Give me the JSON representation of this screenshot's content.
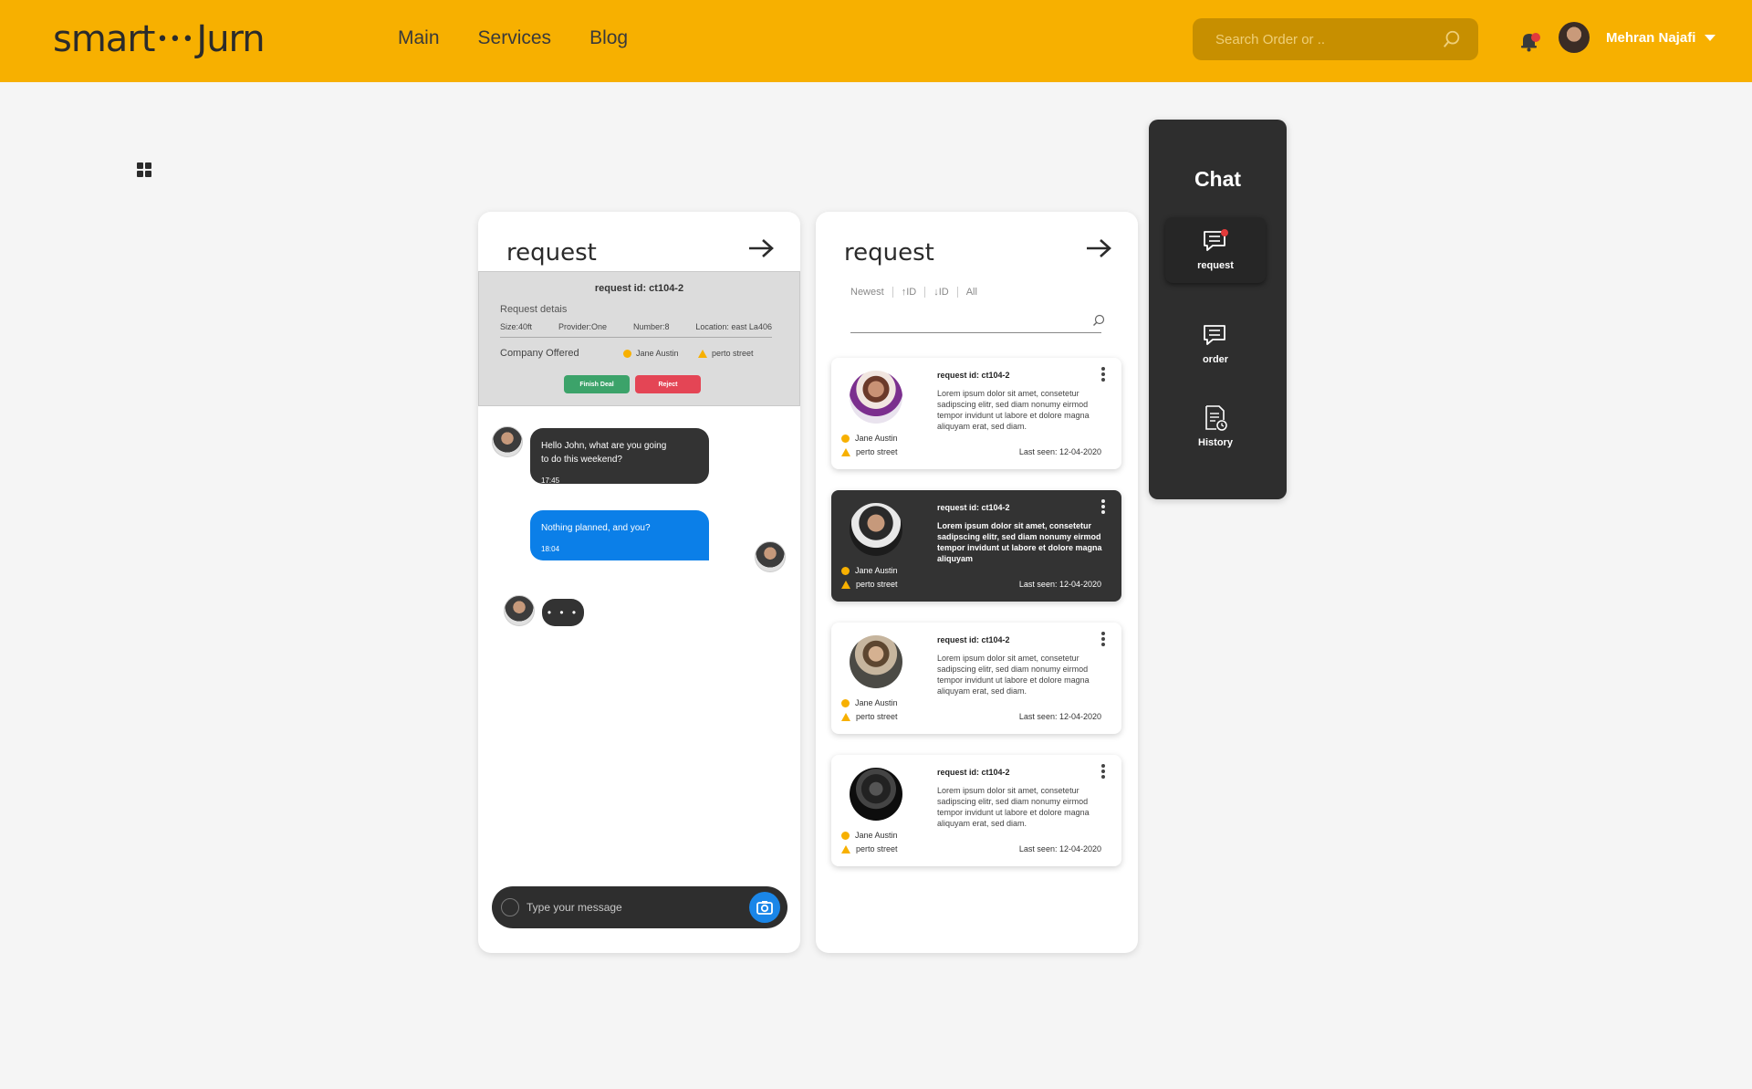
{
  "header": {
    "logo_left": "smart",
    "logo_dots": "•••",
    "logo_right": "Jurn",
    "nav": [
      "Main",
      "Services",
      "Blog"
    ],
    "search_placeholder": "Search Order or ..",
    "user_name": "Mehran Najafi",
    "brand_color": "#f7b000"
  },
  "request_panel": {
    "title": "request",
    "request_id": "request id: ct104-2",
    "details_label": "Request detais",
    "specs": [
      "Size:40ft",
      "Provider:One",
      "Number:8",
      "Location: east La406"
    ],
    "company_label": "Company Offered",
    "person": "Jane Austin",
    "street": "perto street",
    "finish_label": "Finish Deal",
    "reject_label": "Reject",
    "messages": [
      {
        "text_line1": "Hello John, what are you going",
        "text_line2": "to do this weekend?",
        "time": "17:45"
      },
      {
        "text": "Nothing planned, and you?",
        "time": "18:04"
      }
    ],
    "typing": "• • •",
    "compose_placeholder": "Type your message"
  },
  "list_panel": {
    "title": "request",
    "filters": [
      "Newest",
      "↑ID",
      "↓ID",
      "All"
    ],
    "cards": [
      {
        "id": "request id: ct104-2",
        "text": "Lorem ipsum dolor sit amet, consetetur sadipscing elitr, sed diam nonumy eirmod tempor invidunt ut labore et dolore magna aliquyam erat, sed diam.",
        "person": "Jane Austin",
        "street": "perto street",
        "seen": "Last seen: 12-04-2020"
      },
      {
        "id": "request id: ct104-2",
        "text": "Lorem ipsum dolor sit amet, consetetur sadipscing elitr, sed diam nonumy eirmod tempor invidunt ut labore et dolore magna aliquyam",
        "person": "Jane Austin",
        "street": "perto street",
        "seen": "Last seen: 12-04-2020"
      },
      {
        "id": "request id: ct104-2",
        "text": "Lorem ipsum dolor sit amet, consetetur sadipscing elitr, sed diam nonumy eirmod tempor invidunt ut labore et dolore magna aliquyam erat, sed diam.",
        "person": "Jane Austin",
        "street": "perto street",
        "seen": "Last seen: 12-04-2020"
      },
      {
        "id": "request id: ct104-2",
        "text": "Lorem ipsum dolor sit amet, consetetur sadipscing elitr, sed diam nonumy eirmod tempor invidunt ut labore et dolore magna aliquyam erat, sed diam.",
        "person": "Jane Austin",
        "street": "perto street",
        "seen": "Last seen: 12-04-2020"
      }
    ]
  },
  "sidebar": {
    "title": "Chat",
    "items": [
      "request",
      "order",
      "History"
    ]
  }
}
